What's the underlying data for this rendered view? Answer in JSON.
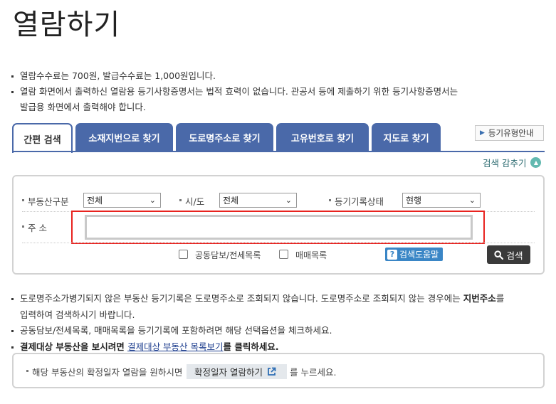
{
  "page": {
    "title": "열람하기"
  },
  "notice": {
    "line1": "열람수수료는 700원, 발급수수료는 1,000원입니다.",
    "line2": "열람 화면에서 출력하신 열람용 등기사항증명서는 법적 효력이 없습니다. 관공서 등에 제출하기 위한 등기사항증명서는",
    "line2b": "발급용 화면에서 출력해야 합니다."
  },
  "tabs": [
    {
      "label": "간편 검색"
    },
    {
      "label": "소재지번으로 찾기"
    },
    {
      "label": "도로명주소로 찾기"
    },
    {
      "label": "고유번호로 찾기"
    },
    {
      "label": "지도로 찾기"
    }
  ],
  "type_guide_button": {
    "label": "등기유형안내"
  },
  "hide_search": {
    "label": "검색 감추기"
  },
  "search": {
    "property_type": {
      "label": "부동산구분",
      "value": "전체"
    },
    "province": {
      "label": "시/도",
      "value": "전체"
    },
    "record_status": {
      "label": "등기기록상태",
      "value": "현행"
    },
    "address": {
      "label": "주 소",
      "value": ""
    },
    "joint_collateral": {
      "label": "공동담보/전세목록"
    },
    "sales_list": {
      "label": "매매목록"
    },
    "help_button": {
      "label": "검색도움말"
    },
    "search_button": {
      "label": "검색"
    }
  },
  "notes": {
    "line1": "도로명주소가병기되지 않은 부동산 등기기록은 도로명주소로 조회되지 않습니다. 도로명주소로 조회되지 않는 경우에는 ",
    "line1_bold": "지번주소",
    "line1_end": "를",
    "line1b": "입력하여 검색하시기 바랍니다.",
    "line2": "공동담보/전세목록, 매매목록을 등기기록에 포함하려면 해당 선택옵션을 체크하세요.",
    "line3_a": "결제대상 부동산을 보시려면 ",
    "line3_link": "결제대상 부동산 목록보기",
    "line3_b": "를 클릭하세요."
  },
  "confirm": {
    "text_before": "해당 부동산의 확정일자 열람을 원하시면",
    "button_label": "확정일자 열람하기",
    "text_after": "를 누르세요."
  },
  "colors": {
    "tab_blue": "#4a69a9",
    "highlight_red": "#e8231f",
    "help_blue": "#3a86c6",
    "teal": "#62b9b0"
  }
}
